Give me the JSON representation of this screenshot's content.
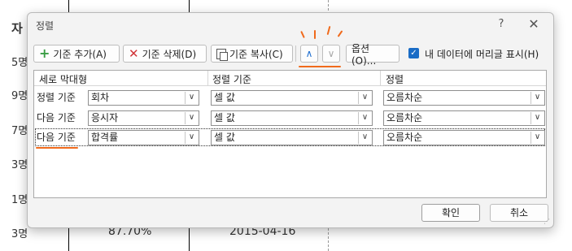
{
  "background": {
    "row_labels": [
      "자",
      "5명",
      "9명",
      "7명",
      "3명",
      "1명",
      "3명"
    ],
    "cells": [
      "87.70%",
      "2015-04-16"
    ]
  },
  "dialog": {
    "title": "정렬",
    "help_label": "?",
    "close_label": "✕",
    "toolbar": {
      "add_label": "기준 추가(A)",
      "delete_label": "기준 삭제(D)",
      "copy_label": "기준 복사(C)",
      "options_label": "옵션(O)...",
      "has_header_label": "내 데이터에 머리글 표시(H)",
      "has_header_checked": true
    },
    "columns": [
      "세로 막대형",
      "정렬 기준",
      "정렬"
    ],
    "rows": [
      {
        "label": "정렬 기준",
        "column": "회차",
        "sort_on": "셀 값",
        "order": "오름차순"
      },
      {
        "label": "다음 기준",
        "column": "응시자",
        "sort_on": "셀 값",
        "order": "오름차순"
      },
      {
        "label": "다음 기준",
        "column": "합격률",
        "sort_on": "셀 값",
        "order": "오름차순"
      }
    ],
    "ok_label": "확인",
    "cancel_label": "취소"
  },
  "colors": {
    "accent": "#1a6cc6",
    "annotation": "#f06a1c"
  }
}
